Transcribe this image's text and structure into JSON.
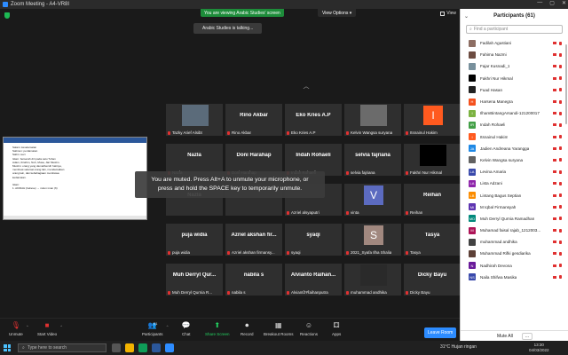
{
  "window": {
    "title": "Zoom Meeting - A4-VR8I",
    "controls": [
      "—",
      "▢",
      "✕"
    ]
  },
  "banner": {
    "viewing": "You are viewing Arabic Studies' screen",
    "view_options": "View Options ▾"
  },
  "talking": "Arabic Studies is talking...",
  "view_button": "View",
  "document": {
    "lines": [
      "Salam: keselamatan",
      "Salimun: perdamaian",
      "Salim: suci",
      "Islam: berserah diri pada satu Tuhan",
      "Adam, Ibrahim, Nuh, Musa, Jiar Muslim.",
      "Muslim: orang yang damai/bersih hatinya,",
      "membuat selamat orang lain, mendamaikan",
      "orang lain, dan kebahagiaan membawa",
      "kedamaian.",
      "",
      "Islam:",
      "1. AKIDAH (believe) → rukun iman (6)"
    ]
  },
  "muted_toast": {
    "line1": "You are muted. Press Alt+A to unmute your microphone, or",
    "line2": "press and hold the SPACE key to temporarily unmute."
  },
  "tiles": [
    {
      "big": "",
      "cap": "Tazky Arief Alsibt",
      "pic": "#5b6b7a"
    },
    {
      "big": "Rino Akbar",
      "cap": "Rino Akbar"
    },
    {
      "big": "Eko Kries A.P",
      "cap": "Eko Kries A.P"
    },
    {
      "big": "",
      "cap": "Kelvin Wangsa suryana",
      "pic": "#6b6b6b"
    },
    {
      "big": "",
      "cap": "Itsnainul Hakim",
      "avatar": "I",
      "avatar_color": "#ff5a1f"
    },
    {
      "big": "Nazla",
      "cap": "Nazla"
    },
    {
      "big": "Doni Harahap",
      "cap": "Doni Harahap"
    },
    {
      "big": "Indah Rohaeli",
      "cap": "Indah Rohaeli"
    },
    {
      "big": "selvia fajriana",
      "cap": "selvia fajriana"
    },
    {
      "big": "",
      "cap": "Fakhri Nur Hikmal",
      "pic": "#000000"
    },
    {
      "big": "Nazla",
      "cap": ""
    },
    {
      "big": "",
      "cap": ""
    },
    {
      "big": "",
      "cap": "Azriel alsyaputri"
    },
    {
      "big": "",
      "cap": "vinta",
      "avatar": "V",
      "avatar_color": "#5c6bc0"
    },
    {
      "big": "Reihan",
      "cap": "Reihan"
    },
    {
      "big": "puja widia",
      "cap": "puja widia"
    },
    {
      "big": "Azriel akshan fir...",
      "cap": "Azriel akshan firmansy..."
    },
    {
      "big": "syaqi",
      "cap": "syaqi"
    },
    {
      "big": "",
      "cap": "2021_Syafa Ilha Shalia",
      "avatar": "S",
      "avatar_color": "#a1887f"
    },
    {
      "big": "Tasya",
      "cap": "Tasya"
    },
    {
      "big": "Muh Derryl Qur...",
      "cap": "Muh Derryl Qurnia R..."
    },
    {
      "big": "nabila s",
      "cap": "nabila s"
    },
    {
      "big": "Alvianto Raihan...",
      "cap": "Alvianto Raihanputra"
    },
    {
      "big": "",
      "cap": "muhammad andhika",
      "pic": "#2a2a2a"
    },
    {
      "big": "Dicky Bayu",
      "cap": "Dicky Bayu"
    }
  ],
  "toolbar": {
    "unmute": "Unmute",
    "start_video": "Start Video",
    "participants": "Participants",
    "participants_count": "61",
    "chat": "Chat",
    "share_screen": "Share Screen",
    "record": "Record",
    "breakout": "Breakout Rooms",
    "reactions": "Reactions",
    "apps": "Apps",
    "leave": "Leave Room"
  },
  "panel": {
    "title": "Participants (61)",
    "search_placeholder": "Find a participant",
    "participants": [
      {
        "name": "Fadilah Agustiani",
        "color": "#8d6e63"
      },
      {
        "name": "Fahima Nazmi",
        "color": "#6d4c41"
      },
      {
        "name": "Fajar Kusnadi_1",
        "color": "#78909c"
      },
      {
        "name": "Fakhri Nur Hikmal",
        "color": "#000000"
      },
      {
        "name": "Fuad Hasan",
        "color": "#212121"
      },
      {
        "name": "Harsena Manegra",
        "color": "#f4511e",
        "initial": "H"
      },
      {
        "name": "IlhamBintangArsandi-121200017",
        "color": "#7cb342",
        "initial": "I"
      },
      {
        "name": "Indah Rohaeli",
        "color": "#43a047",
        "initial": "IR"
      },
      {
        "name": "Itsnainul Hakim",
        "color": "#ff5a1f",
        "initial": "I"
      },
      {
        "name": "Jadien Andreana Yarangga",
        "color": "#1e88e5",
        "initial": "JA"
      },
      {
        "name": "Kelvin Wangsa suryana",
        "color": "#616161"
      },
      {
        "name": "Levina Amaria",
        "color": "#3949ab",
        "initial": "LA"
      },
      {
        "name": "Lista Adzani",
        "color": "#8e24aa",
        "initial": "LA"
      },
      {
        "name": "Lintang Bagus Septian",
        "color": "#fb8c00",
        "initial": "LB"
      },
      {
        "name": "M Iqbal Firmansyah",
        "color": "#5e35b1",
        "initial": "MI"
      },
      {
        "name": "Muh Derryl Qurnia Ramadhan",
        "color": "#00897b",
        "initial": "MD"
      },
      {
        "name": "Muhamad faisal rajab_1212003...",
        "color": "#ad1457",
        "initial": "M"
      },
      {
        "name": "muhammad andhika",
        "color": "#424242"
      },
      {
        "name": "Muhammad Rifki gesdiarika",
        "color": "#5d4037"
      },
      {
        "name": "Nadhirah Devona",
        "color": "#6a1b9a",
        "initial": "N"
      },
      {
        "name": "Naila Shifwa Masika",
        "color": "#3949ab",
        "initial": "NS"
      }
    ],
    "mute_all": "Mute All",
    "more": "..."
  },
  "taskbar": {
    "search": "Type here to search",
    "weather": "31°C  Hujan ringan",
    "time": "13:30",
    "date": "04/03/2022"
  }
}
